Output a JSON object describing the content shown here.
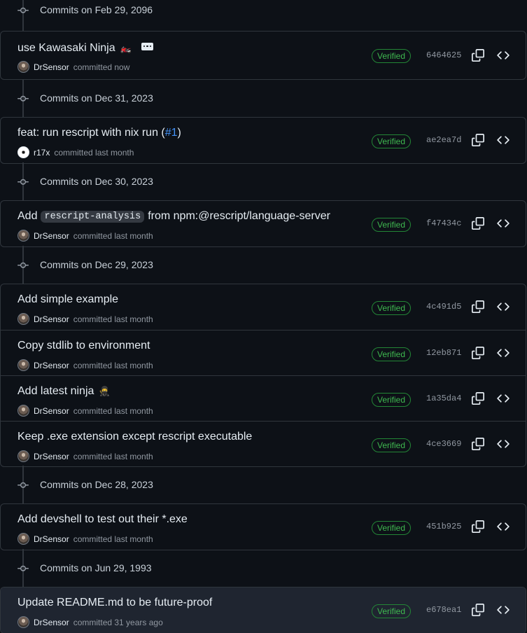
{
  "groups": [
    {
      "label": "Commits on Feb 29, 2096",
      "commits": [
        {
          "title": "use Kawasaki Ninja",
          "emoji": "🏍️",
          "author": "DrSensor",
          "committed_text": "committed now",
          "verified": "Verified",
          "sha": "6464625"
        }
      ]
    },
    {
      "label": "Commits on Dec 31, 2023",
      "commits": [
        {
          "title": "feat: run rescript with nix run (",
          "pr": "#1",
          "title_end": ")",
          "author": "r17x",
          "committed_text": "committed last month",
          "verified": "Verified",
          "sha": "ae2ea7d"
        }
      ]
    },
    {
      "label": "Commits on Dec 30, 2023",
      "commits": [
        {
          "title": "Add",
          "code": "rescript-analysis",
          "title_end": "from npm:@rescript/language-server",
          "author": "DrSensor",
          "committed_text": "committed last month",
          "verified": "Verified",
          "sha": "f47434c"
        }
      ]
    },
    {
      "label": "Commits on Dec 29, 2023",
      "commits": [
        {
          "title": "Add simple example",
          "author": "DrSensor",
          "committed_text": "committed last month",
          "verified": "Verified",
          "sha": "4c491d5"
        },
        {
          "title": "Copy stdlib to environment",
          "author": "DrSensor",
          "committed_text": "committed last month",
          "verified": "Verified",
          "sha": "12eb871"
        },
        {
          "title": "Add latest ninja",
          "emoji": "🥷",
          "author": "DrSensor",
          "committed_text": "committed last month",
          "verified": "Verified",
          "sha": "1a35da4"
        },
        {
          "title": "Keep .exe extension except rescript executable",
          "author": "DrSensor",
          "committed_text": "committed last month",
          "verified": "Verified",
          "sha": "4ce3669"
        }
      ]
    },
    {
      "label": "Commits on Dec 28, 2023",
      "commits": [
        {
          "title": "Add devshell to test out their *.exe",
          "author": "DrSensor",
          "committed_text": "committed last month",
          "verified": "Verified",
          "sha": "451b925"
        }
      ]
    },
    {
      "label": "Commits on Jun 29, 1993",
      "commits": [
        {
          "title": "Update README.md to be future-proof",
          "author": "DrSensor",
          "committed_text": "committed 31 years ago",
          "verified": "Verified",
          "sha": "e678ea1"
        }
      ]
    }
  ],
  "icons": {
    "commit": "git-commit-icon",
    "copy": "copy-icon",
    "browse": "code-icon",
    "more": "ellipsis-icon"
  },
  "colors": {
    "background": "#0d1117",
    "border": "#30363d",
    "verified": "#3fb950",
    "link": "#4493f8"
  }
}
